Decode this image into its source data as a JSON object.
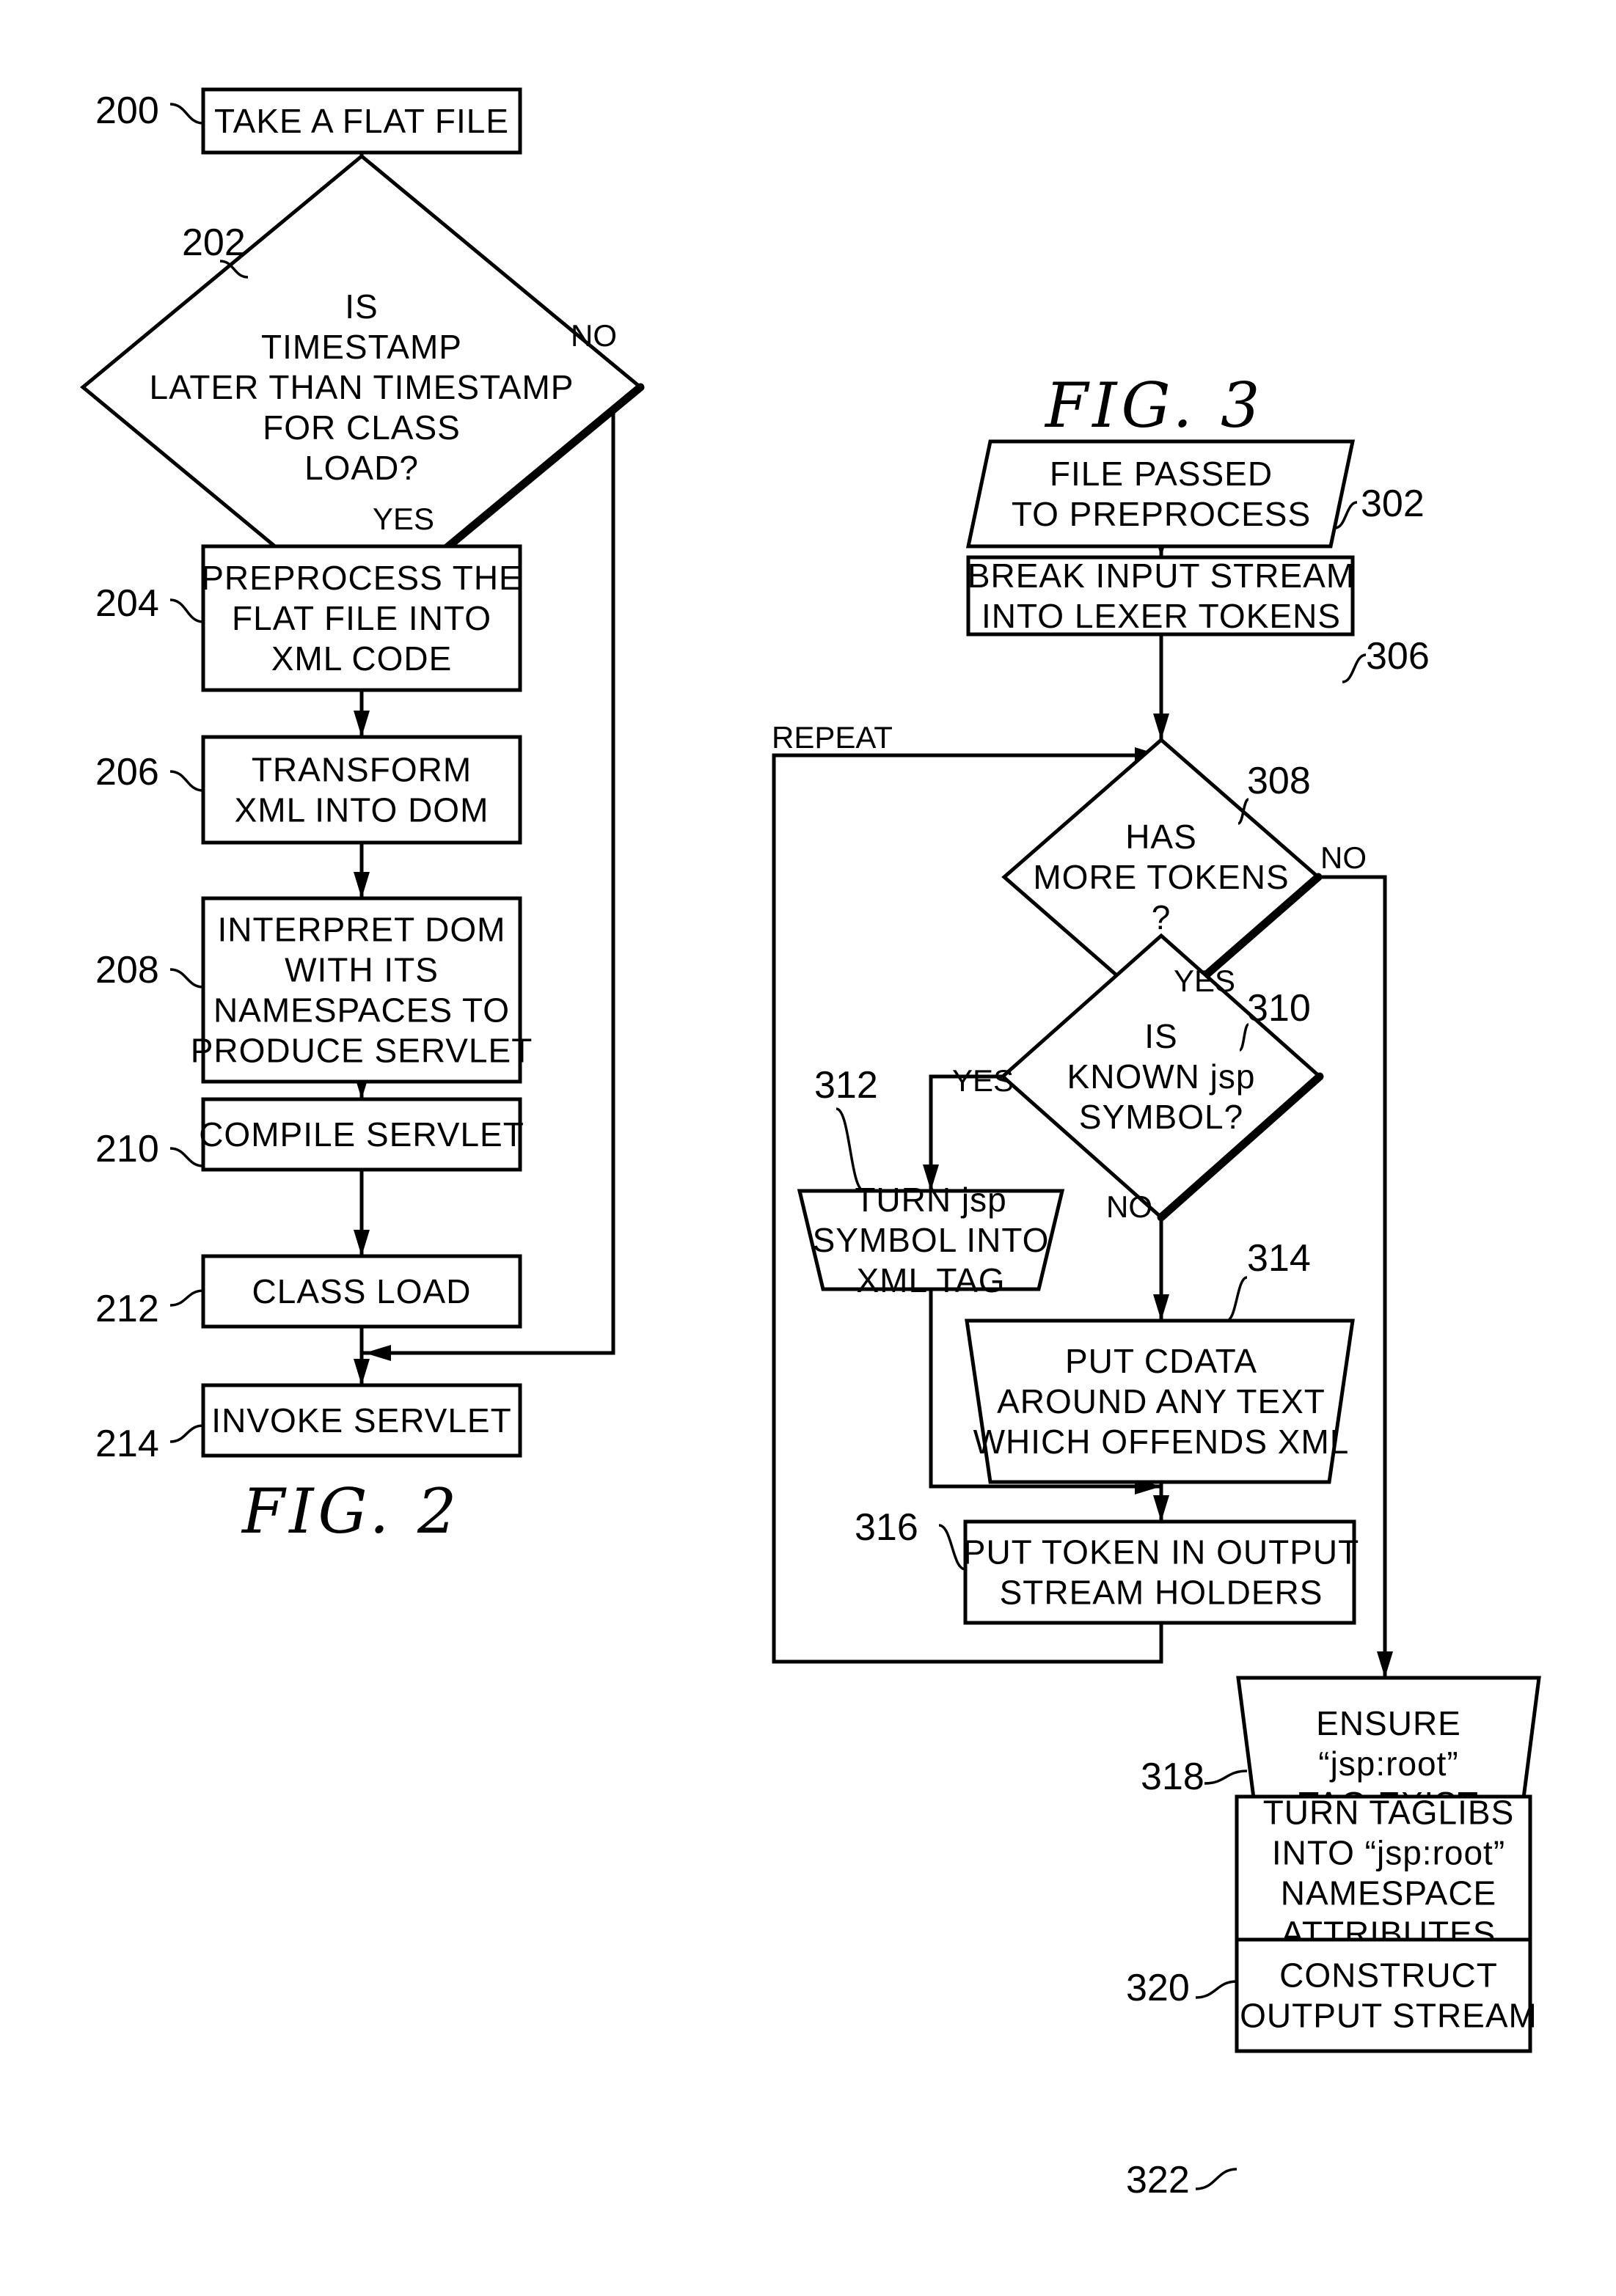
{
  "figures": [
    {
      "title": "FIG. 2",
      "nodes": [
        {
          "id": "200",
          "shape": "process",
          "lines": [
            "TAKE A FLAT FILE"
          ]
        },
        {
          "id": "202",
          "shape": "decision",
          "lines": [
            "IS",
            "TIMESTAMP",
            "LATER THAN TIMESTAMP",
            "FOR CLASS",
            "LOAD?"
          ]
        },
        {
          "id": "204",
          "shape": "process",
          "lines": [
            "PREPROCESS THE",
            "FLAT FILE INTO",
            "XML CODE"
          ]
        },
        {
          "id": "206",
          "shape": "process",
          "lines": [
            "TRANSFORM",
            "XML INTO DOM"
          ]
        },
        {
          "id": "208",
          "shape": "process",
          "lines": [
            "INTERPRET DOM",
            "WITH ITS",
            "NAMESPACES TO",
            "PRODUCE SERVLET"
          ]
        },
        {
          "id": "210",
          "shape": "process",
          "lines": [
            "COMPILE SERVLET"
          ]
        },
        {
          "id": "212",
          "shape": "process",
          "lines": [
            "CLASS LOAD"
          ]
        },
        {
          "id": "214",
          "shape": "process",
          "lines": [
            "INVOKE SERVLET"
          ]
        }
      ],
      "edges": [
        {
          "from": "200",
          "to": "202",
          "label": ""
        },
        {
          "from": "202",
          "to": "204",
          "label": "YES"
        },
        {
          "from": "202",
          "to": "214",
          "label": "NO"
        },
        {
          "from": "204",
          "to": "206",
          "label": ""
        },
        {
          "from": "206",
          "to": "208",
          "label": ""
        },
        {
          "from": "208",
          "to": "210",
          "label": ""
        },
        {
          "from": "210",
          "to": "212",
          "label": ""
        },
        {
          "from": "212",
          "to": "214",
          "label": ""
        }
      ]
    },
    {
      "title": "FIG. 3",
      "nodes": [
        {
          "id": "302",
          "shape": "input",
          "lines": [
            "FILE PASSED",
            "TO PREPROCESS"
          ]
        },
        {
          "id": "306",
          "shape": "process",
          "lines": [
            "BREAK INPUT STREAM",
            "INTO LEXER TOKENS"
          ]
        },
        {
          "id": "308",
          "shape": "decision",
          "lines": [
            "HAS",
            "MORE TOKENS",
            "?"
          ]
        },
        {
          "id": "310",
          "shape": "decision",
          "lines": [
            "IS",
            "KNOWN jsp",
            "SYMBOL?"
          ]
        },
        {
          "id": "312",
          "shape": "manual",
          "lines": [
            "TURN jsp",
            "SYMBOL INTO",
            "XML TAG"
          ]
        },
        {
          "id": "314",
          "shape": "manual",
          "lines": [
            "PUT CDATA",
            "AROUND ANY TEXT",
            "WHICH OFFENDS XML"
          ]
        },
        {
          "id": "316",
          "shape": "process",
          "lines": [
            "PUT TOKEN IN OUTPUT",
            "STREAM HOLDERS"
          ]
        },
        {
          "id": "318",
          "shape": "manual",
          "lines": [
            "ENSURE",
            "“jsp:root”",
            "TAG EXIST"
          ]
        },
        {
          "id": "320",
          "shape": "process",
          "lines": [
            "TURN TAGLIBS",
            "INTO “jsp:root”",
            "NAMESPACE",
            "ATTRIBUTES"
          ]
        },
        {
          "id": "322",
          "shape": "process",
          "lines": [
            "CONSTRUCT",
            "OUTPUT STREAM"
          ]
        }
      ],
      "edges": [
        {
          "from": "302",
          "to": "306",
          "label": ""
        },
        {
          "from": "306",
          "to": "308",
          "label": ""
        },
        {
          "from": "308",
          "to": "310",
          "label": "YES"
        },
        {
          "from": "308",
          "to": "318",
          "label": "NO"
        },
        {
          "from": "310",
          "to": "312",
          "label": "YES"
        },
        {
          "from": "310",
          "to": "314",
          "label": "NO"
        },
        {
          "from": "312",
          "to": "316",
          "label": ""
        },
        {
          "from": "314",
          "to": "316",
          "label": ""
        },
        {
          "from": "316",
          "to": "308",
          "label": "REPEAT"
        },
        {
          "from": "318",
          "to": "320",
          "label": ""
        },
        {
          "from": "320",
          "to": "322",
          "label": ""
        }
      ]
    }
  ]
}
